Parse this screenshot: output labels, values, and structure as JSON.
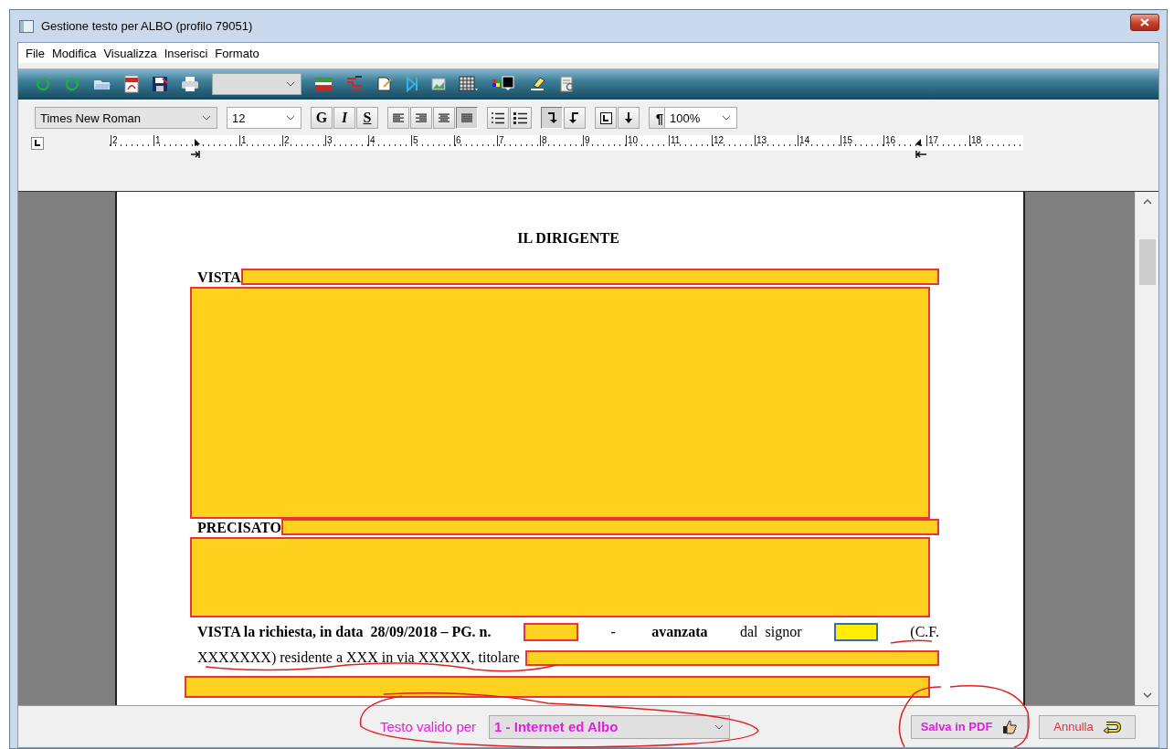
{
  "window": {
    "title": "Gestione testo per ALBO (profilo 79051)"
  },
  "menu": [
    "File",
    "Modifica",
    "Visualizza",
    "Inserisci",
    "Formato"
  ],
  "format_bar": {
    "font": "Times New Roman",
    "size": "12",
    "style_buttons": [
      "G",
      "I",
      "S"
    ],
    "align_buttons": [
      {
        "selected": false
      },
      {
        "selected": false
      },
      {
        "selected": false
      },
      {
        "selected": true
      }
    ],
    "arrow_buttons": [
      {
        "selected": true
      },
      {
        "selected": false
      }
    ],
    "pilcrow": "¶",
    "zoom": "100%"
  },
  "ruler": {
    "labels": [
      "2",
      "1",
      "1",
      "2",
      "3",
      "4",
      "5",
      "6",
      "7",
      "8",
      "9",
      "10",
      "11",
      "12",
      "13",
      "14",
      "15",
      "16",
      "17",
      "18"
    ]
  },
  "document": {
    "blocks": [
      {
        "kind": "heading",
        "text": "IL DIRIGENTE"
      },
      {
        "kind": "labelled",
        "label": "VISTA"
      },
      {
        "kind": "redaction"
      },
      {
        "kind": "labelled",
        "label": "PRECISATO"
      },
      {
        "kind": "redaction"
      },
      {
        "kind": "line",
        "segments": [
          {
            "kind": "text",
            "text": "VISTA la richiesta, in data  28/09/2018 – PG. n.",
            "bold": true
          },
          {
            "kind": "redaction"
          },
          {
            "kind": "text",
            "text": "- ",
            "bold": false
          },
          {
            "kind": "text",
            "text": "avanzata",
            "bold": true
          },
          {
            "kind": "text",
            "text": "dal  signor",
            "bold": false
          },
          {
            "kind": "highlight"
          },
          {
            "kind": "text",
            "text": "(C.F.",
            "bold": false
          }
        ]
      },
      {
        "kind": "line",
        "segments": [
          {
            "kind": "text",
            "text": "XXXXXXX) residente a XXX in via XXXXX, titolare",
            "bold": false
          },
          {
            "kind": "redaction"
          }
        ]
      },
      {
        "kind": "redaction"
      }
    ]
  },
  "footer": {
    "label": "Testo valido per",
    "select": "1 - Internet ed Albo",
    "buttons": [
      {
        "kind": "pdf",
        "label": "Salva in PDF"
      },
      {
        "kind": "cancel",
        "label": "Annulla"
      }
    ]
  }
}
